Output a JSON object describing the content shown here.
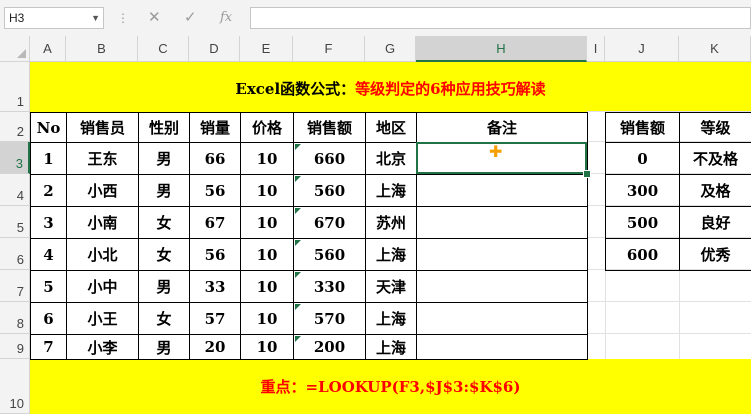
{
  "formula_bar": {
    "name_box": "H3",
    "cancel_icon": "✕",
    "enter_icon": "✓",
    "fx_label": "fx",
    "formula": ""
  },
  "columns": [
    "A",
    "B",
    "C",
    "D",
    "E",
    "F",
    "G",
    "H",
    "I",
    "J",
    "K"
  ],
  "rows": [
    "1",
    "2",
    "3",
    "4",
    "5",
    "6",
    "7",
    "8",
    "9",
    "10"
  ],
  "selected_cell": "H3",
  "title": {
    "prefix": "Excel函数公式：",
    "highlight": "等级判定的6种应用技巧解读",
    "prefix_color": "#000000",
    "highlight_color": "#ff0000"
  },
  "footer": {
    "label": "重点：",
    "formula": "=LOOKUP(F3,$J$3:$K$6)",
    "color": "#ff0000"
  },
  "band_color": "#ffff00",
  "main_table": {
    "headers": [
      "No",
      "销售员",
      "性别",
      "销量",
      "价格",
      "销售额",
      "地区",
      "备注"
    ],
    "rows": [
      [
        "1",
        "王东",
        "男",
        "66",
        "10",
        "660",
        "北京",
        ""
      ],
      [
        "2",
        "小西",
        "男",
        "56",
        "10",
        "560",
        "上海",
        ""
      ],
      [
        "3",
        "小南",
        "女",
        "67",
        "10",
        "670",
        "苏州",
        ""
      ],
      [
        "4",
        "小北",
        "女",
        "56",
        "10",
        "560",
        "上海",
        ""
      ],
      [
        "5",
        "小中",
        "男",
        "33",
        "10",
        "330",
        "天津",
        ""
      ],
      [
        "6",
        "小王",
        "女",
        "57",
        "10",
        "570",
        "上海",
        ""
      ],
      [
        "7",
        "小李",
        "男",
        "20",
        "10",
        "200",
        "上海",
        ""
      ]
    ]
  },
  "lookup_table": {
    "headers": [
      "销售额",
      "等级"
    ],
    "rows": [
      [
        "0",
        "不及格"
      ],
      [
        "300",
        "及格"
      ],
      [
        "500",
        "良好"
      ],
      [
        "600",
        "优秀"
      ]
    ]
  }
}
